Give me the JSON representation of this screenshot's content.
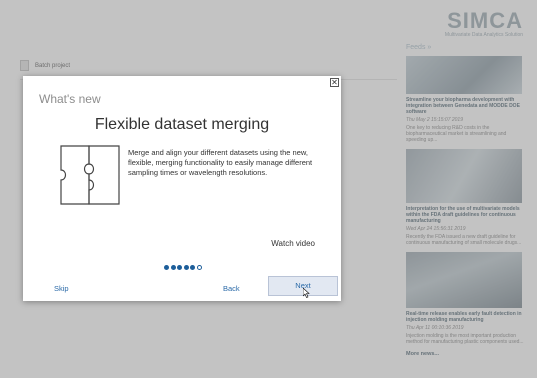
{
  "app": {
    "project_item": "Batch project",
    "brand_title": "SIMCA",
    "brand_subtitle": "Multivariate Data Analytics Solution"
  },
  "feeds": {
    "header": "Feeds »",
    "items": [
      {
        "title": "Streamline your biopharma development with integration between Genedata and MODDE DOE software",
        "date": "Thu May 2 15:15:07 2019",
        "body": "One key to reducing R&D costs in the biopharmaceutical market is streamlining and speeding up..."
      },
      {
        "title": "Interpretation for the use of multivariate models within the FDA draft guidelines for continuous manufacturing",
        "date": "Wed Apr 24 15:56:31 2019",
        "body": "Recently the FDA issued a new draft guideline for continuous manufacturing of small molecule drugs..."
      },
      {
        "title": "Real-time release enables early fault detection in injection molding manufacturing",
        "date": "Thu Apr 11 00:10:36 2019",
        "body": "Injection molding is the most important production method for manufacturing plastic components used..."
      }
    ],
    "more_news": "More news..."
  },
  "modal": {
    "close_glyph": "✕",
    "heading": "What's new",
    "feature_title": "Flexible dataset merging",
    "description": "Merge and align your different datasets using the new, flexible, merging functionality to easily manage different sampling times or wavelength resolutions.",
    "watch_video": "Watch video",
    "page_indicator": {
      "current": 5,
      "total": 6
    },
    "skip": "Skip",
    "back": "Back",
    "next": "Next"
  }
}
